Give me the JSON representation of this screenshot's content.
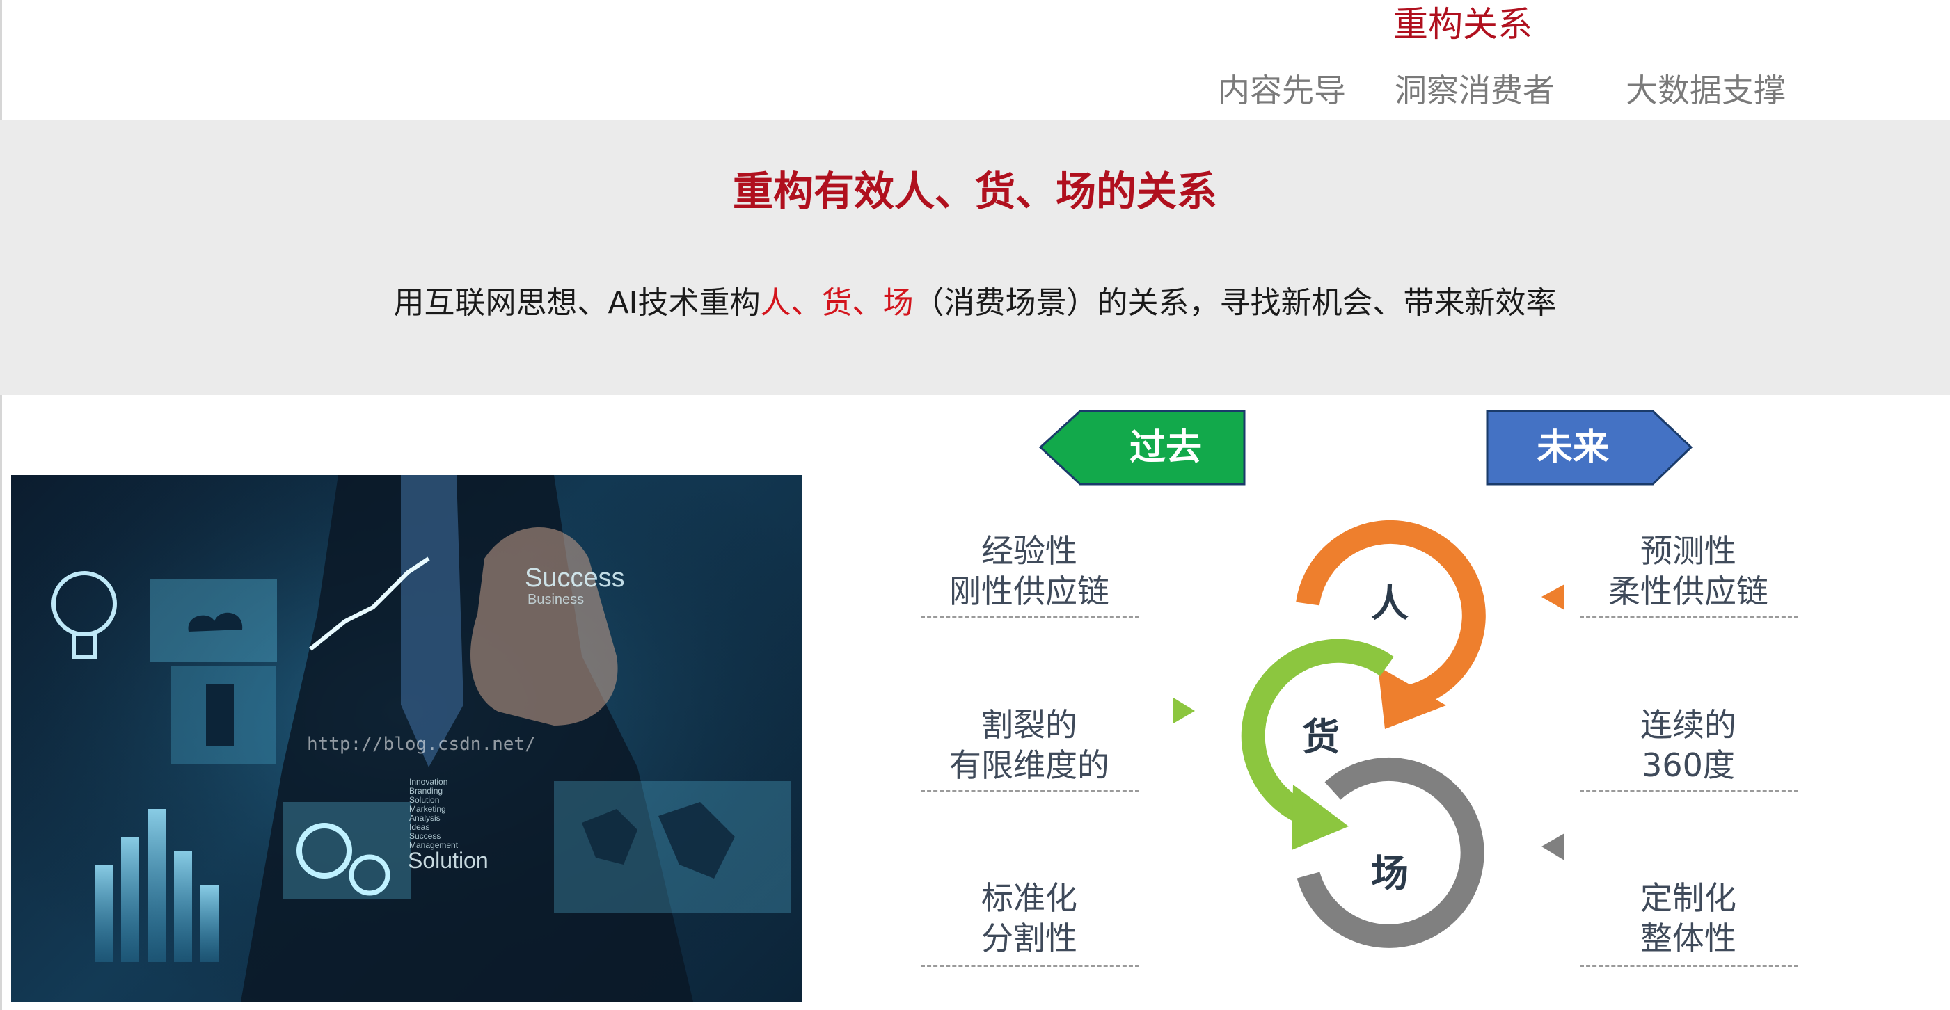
{
  "nav": {
    "active": "重构关系",
    "items": [
      "内容先导",
      "洞察消费者",
      "大数据支撑"
    ]
  },
  "banner": {
    "title": "重构有效人、货、场的关系",
    "subtitle_prefix": "用互联网思想、AI技术重构",
    "subtitle_highlight": "人、货、场",
    "subtitle_suffix": "（消费场景）的关系，寻找新机会、带来新效率"
  },
  "photo": {
    "success_text": "Success",
    "business_text": "Business",
    "solution_text": "Solution",
    "watermark": "http://blog.csdn.net/",
    "small_list": [
      "Innovation",
      "Branding",
      "Solution",
      "Marketing",
      "Analysis",
      "Ideas",
      "Success",
      "Management"
    ]
  },
  "diagram": {
    "past_label": "过去",
    "future_label": "未来",
    "past": [
      {
        "line1": "经验性",
        "line2": "刚性供应链"
      },
      {
        "line1": "割裂的",
        "line2": "有限维度的"
      },
      {
        "line1": "标准化",
        "line2": "分割性"
      }
    ],
    "future": [
      {
        "line1": "预测性",
        "line2": "柔性供应链"
      },
      {
        "line1": "连续的",
        "line2": "360度"
      },
      {
        "line1": "定制化",
        "line2": "整体性"
      }
    ],
    "cycle": [
      "人",
      "货",
      "场"
    ],
    "colors": {
      "past_tag": "#12a94b",
      "future_tag": "#4472c4",
      "ren": "#ee7f2d",
      "huo": "#8cc63f",
      "chang": "#808080",
      "title_red": "#b0101e",
      "highlight_red": "#d3141c"
    }
  }
}
